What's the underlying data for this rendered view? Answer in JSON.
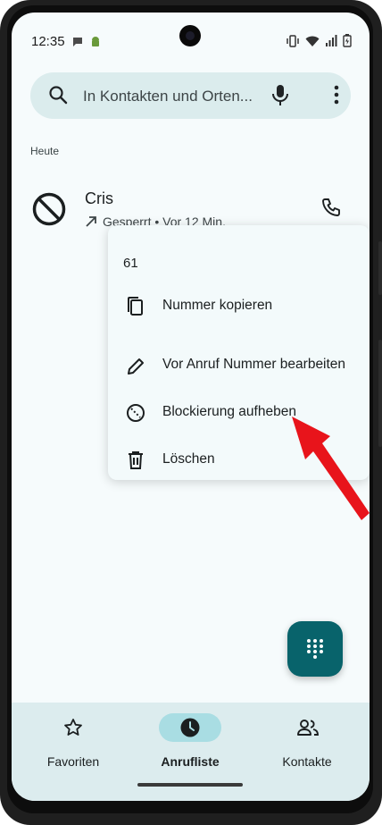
{
  "status_bar": {
    "time": "12:35",
    "icons_left": [
      "chat-bubble-icon",
      "android-icon"
    ],
    "icons_right": [
      "vibrate-icon",
      "wifi-icon",
      "signal-icon",
      "battery-icon"
    ]
  },
  "search": {
    "placeholder": "In Kontakten und Orten...",
    "icons": [
      "search-icon",
      "mic-icon",
      "more-vert-icon"
    ]
  },
  "section_label": "Heute",
  "call": {
    "name": "Cris",
    "status": "Gesperrt • Vor 12 Min.",
    "direction_icon": "outgoing-arrow-icon",
    "avatar_icon": "blocked-icon"
  },
  "menu": {
    "number": "61",
    "items": [
      {
        "label": "Nummer kopieren",
        "icon": "copy-icon"
      },
      {
        "label": "Vor Anruf Nummer bearbeiten",
        "icon": "pencil-icon"
      },
      {
        "label": "Blockierung aufheben",
        "icon": "unblock-icon"
      },
      {
        "label": "Löschen",
        "icon": "trash-icon"
      }
    ]
  },
  "fab": {
    "icon": "dialpad-icon"
  },
  "bottom_nav": {
    "items": [
      {
        "label": "Favoriten",
        "icon": "star-icon"
      },
      {
        "label": "Anrufliste",
        "icon": "clock-icon",
        "active": true
      },
      {
        "label": "Kontakte",
        "icon": "people-icon"
      }
    ]
  },
  "colors": {
    "screen_bg": "#f6fbfc",
    "search_bg": "#dbeced",
    "fab_bg": "#08636b",
    "nav_bg": "#dcecee",
    "active_pill": "#a9dde3",
    "arrow_red": "#e8141b"
  }
}
